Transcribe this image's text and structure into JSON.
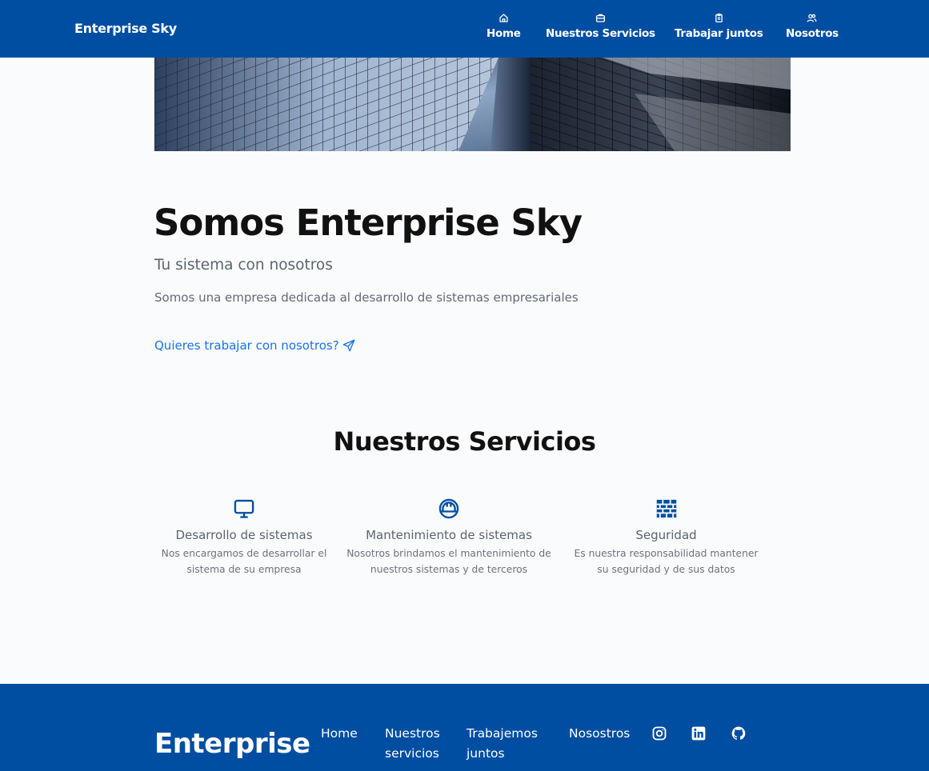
{
  "header": {
    "brand": "Enterprise Sky",
    "nav": [
      {
        "label": "Home",
        "icon": "home-icon"
      },
      {
        "label": "Nuestros Servicios",
        "icon": "briefcase-icon"
      },
      {
        "label": "Trabajar juntos",
        "icon": "clipboard-icon"
      },
      {
        "label": "Nosotros",
        "icon": "users-icon"
      }
    ]
  },
  "hero": {
    "image": "skyscraper-glass-facade"
  },
  "intro": {
    "title": "Somos Enterprise Sky",
    "subtitle": "Tu sistema con nosotros",
    "description": "Somos una empresa dedicada al desarrollo de sistemas empresariales",
    "cta_label": "Quieres trabajar con nosotros?",
    "cta_icon": "send-icon"
  },
  "services": {
    "title": "Nuestros Servicios",
    "items": [
      {
        "icon": "monitor-icon",
        "name": "Desarrollo de sistemas",
        "desc_line1": "Nos encargamos de desarrollar el",
        "desc_line2": "sistema de su empresa"
      },
      {
        "icon": "helmet-icon",
        "name": "Mantenimiento de sistemas",
        "desc_line1": "Nosotros brindamos el mantenimiento de",
        "desc_line2": "nuestros sistemas y de terceros"
      },
      {
        "icon": "firewall-icon",
        "name": "Seguridad",
        "desc_line1": "Es nuestra responsabilidad mantener",
        "desc_line2": "su seguridad y de sus datos"
      }
    ]
  },
  "footer": {
    "brand": "Enterprise",
    "links": [
      {
        "line1": "Home",
        "line2": ""
      },
      {
        "line1": "Nuestros",
        "line2": "servicios"
      },
      {
        "line1": "Trabajemos",
        "line2": "juntos"
      },
      {
        "line1": "Nosostros",
        "line2": ""
      }
    ],
    "social": [
      "instagram-icon",
      "linkedin-icon",
      "github-icon"
    ]
  },
  "colors": {
    "primary": "#004ea2",
    "link": "#1a73e8",
    "page_background": "#fafbfd"
  }
}
